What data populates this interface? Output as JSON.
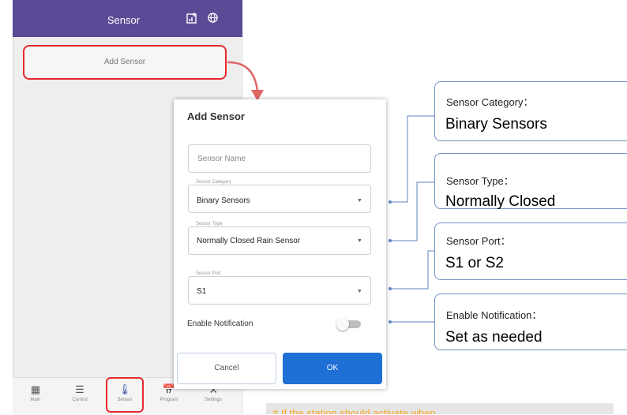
{
  "app": {
    "title": "Sensor",
    "icons": [
      "chart-add-icon",
      "globe-icon"
    ],
    "colors": {
      "appbar": "#5b4a96",
      "highlight": "#e8282e",
      "primary": "#1e6fd6",
      "callout_border": "#6f93c4",
      "arrow": "#e06666"
    }
  },
  "main": {
    "add_sensor_label": "Add Sensor"
  },
  "bottom_nav": [
    {
      "label": "Main",
      "icon": "grid-icon"
    },
    {
      "label": "Control",
      "icon": "sliders-icon"
    },
    {
      "label": "Sensor",
      "icon": "thermometer-icon",
      "selected": true
    },
    {
      "label": "Program",
      "icon": "calendar-icon"
    },
    {
      "label": "Settings",
      "icon": "tools-icon"
    }
  ],
  "dialog": {
    "title": "Add Sensor",
    "name_placeholder": "Sensor Name",
    "category": {
      "label": "Sensor Category",
      "value": "Binary Sensors"
    },
    "type": {
      "label": "Sensor Type",
      "value": "Normally Closed Rain Sensor"
    },
    "port": {
      "label": "Sensor Port",
      "value": "S1"
    },
    "notification_label": "Enable Notification",
    "notification_enabled": false,
    "cancel_label": "Cancel",
    "ok_label": "OK"
  },
  "callouts": [
    {
      "title": "Sensor Category：",
      "value": "Binary Sensors"
    },
    {
      "title": "Sensor Type：",
      "value": "Normally Closed"
    },
    {
      "title": "Sensor Port：",
      "value": "S1 or S2"
    },
    {
      "title": "Enable Notification：",
      "value": "Set as needed"
    }
  ],
  "note": "# If the station should activate when"
}
